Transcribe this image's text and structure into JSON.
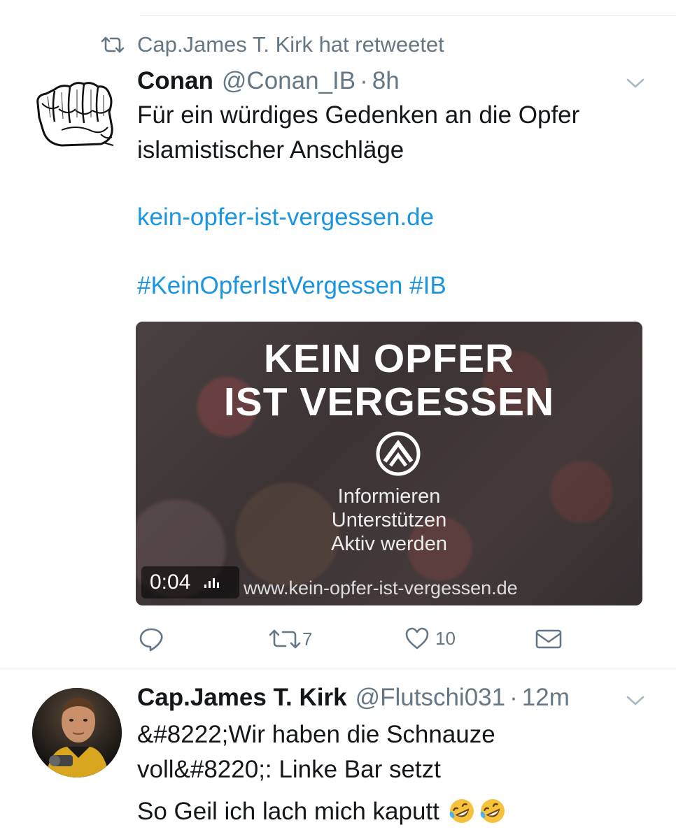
{
  "retweet": {
    "label": "Cap.James T. Kirk hat retweetet",
    "icon": "retweet-icon"
  },
  "tweet1": {
    "name": "Conan",
    "handle": "@Conan_IB",
    "separator": "·",
    "time": "8h",
    "text_line1": "Für ein würdiges Gedenken an die Opfer",
    "text_line2": "islamistischer Anschläge",
    "link": "kein-opfer-ist-vergessen.de",
    "hashtag1": "#KeinOpferIstVergessen",
    "hashtag2": "#IB",
    "media": {
      "headline1": "KEIN OPFER",
      "headline2": "IST VERGESSEN",
      "sub1": "Informieren",
      "sub2": "Unterstützen",
      "sub3": "Aktiv werden",
      "url": "www.kein-opfer-ist-vergessen.de",
      "duration": "0:04"
    },
    "actions": {
      "reply_count": "",
      "retweet_count": "7",
      "like_count": "10"
    }
  },
  "tweet2": {
    "name": "Cap.James T. Kirk",
    "handle": "@Flutschi031",
    "separator": "·",
    "time": "12m",
    "text_line1": "&#8222;Wir haben die Schnauze",
    "text_line2": "voll&#8220;: Linke Bar setzt",
    "text_line3": "So Geil ich lach mich kaputt"
  },
  "colors": {
    "link": "#1b95e0",
    "secondary": "#657786",
    "text": "#14171a",
    "divider": "#e6ecf0"
  }
}
